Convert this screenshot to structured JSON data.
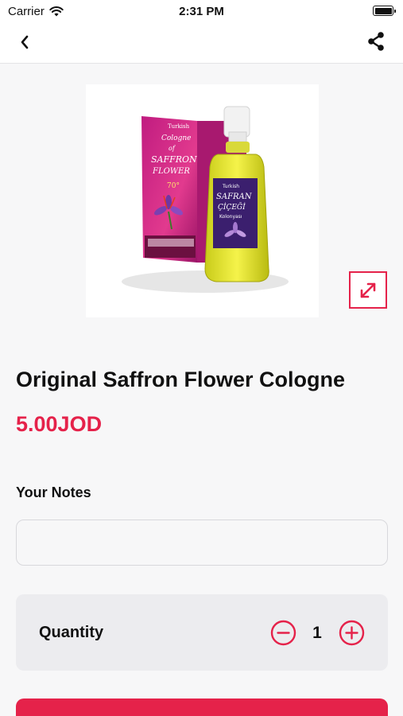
{
  "status_bar": {
    "carrier": "Carrier",
    "time": "2:31 PM",
    "wifi_icon": "wifi-icon",
    "battery_icon": "battery-icon"
  },
  "nav": {
    "back_icon": "chevron-left-icon",
    "share_icon": "share-icon"
  },
  "product": {
    "image_icon": "cologne-bottle-image",
    "image_texts": [
      "Turkish",
      "Cologne",
      "of",
      "SAFFRON",
      "FLOWER",
      "70°",
      "SAFRAN",
      "ÇİÇEĞİ",
      "Kolonyası"
    ],
    "expand_icon": "expand-arrows-icon",
    "title": "Original Saffron Flower Cologne",
    "price": "5.00JOD"
  },
  "notes": {
    "label": "Your Notes",
    "value": "",
    "placeholder": ""
  },
  "quantity": {
    "label": "Quantity",
    "value": "1",
    "minus_icon": "minus-circle-icon",
    "plus_icon": "plus-circle-icon"
  },
  "colors": {
    "accent": "#e5224a",
    "background": "#f7f7f8",
    "card": "#ececef"
  }
}
